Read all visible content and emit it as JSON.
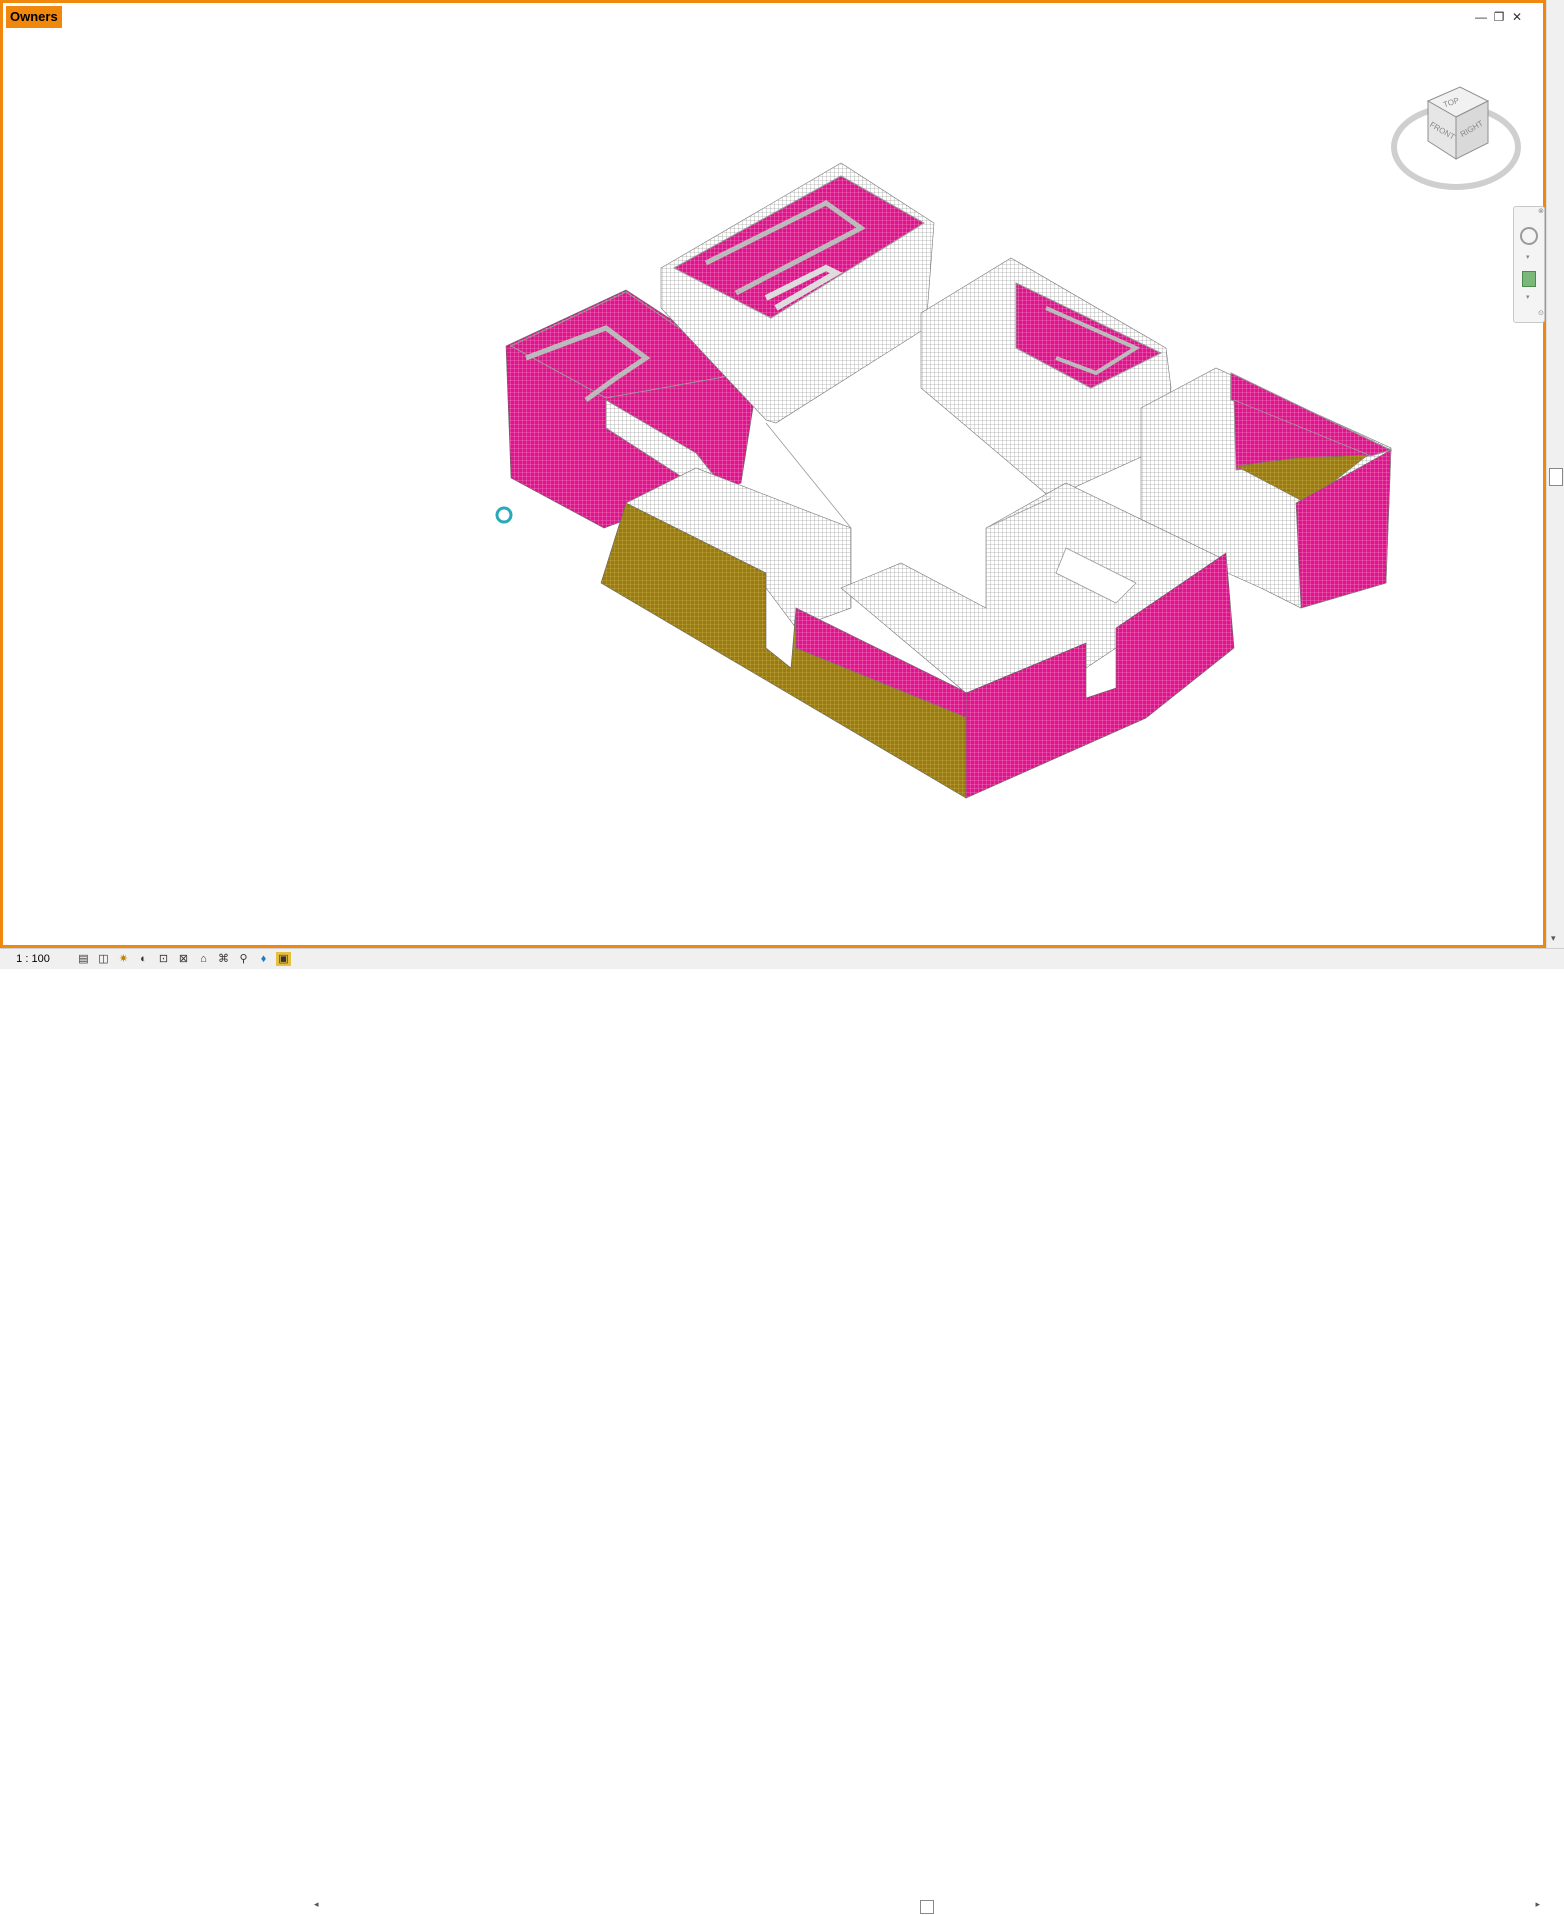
{
  "view": {
    "title": "Owners",
    "window_controls": {
      "minimize": "—",
      "restore": "❐",
      "close": "✕"
    }
  },
  "viewcube": {
    "faces": {
      "top": "TOP",
      "front": "FRONT",
      "right": "RIGHT"
    }
  },
  "statusbar": {
    "scale": "1 : 100",
    "icons": [
      "detail-level-icon",
      "visual-style-icon",
      "sun-path-icon",
      "shadows-icon",
      "crop-view-icon",
      "show-crop-icon",
      "temporary-hide-icon",
      "reveal-hidden-icon",
      "lock-3d-icon",
      "analytical-model-icon",
      "highlight-displacement-icon",
      "reveal-constraints-icon"
    ]
  },
  "colors": {
    "frame": "#f0880e",
    "magenta": "#e0138c",
    "olive": "#9a7a12",
    "grey": "#b8b8b8"
  }
}
